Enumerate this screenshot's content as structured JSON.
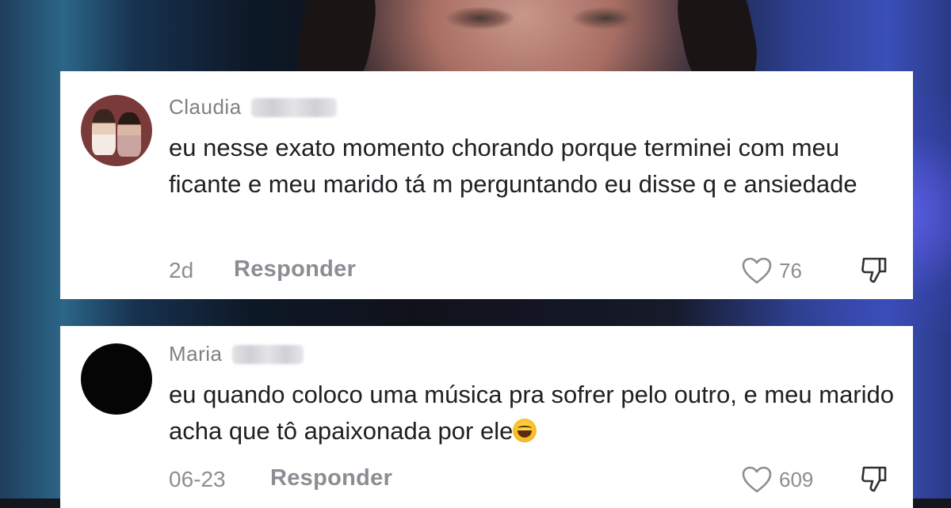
{
  "comments": [
    {
      "author": "Claudia",
      "text": "eu nesse exato momento chorando porque terminei com meu ficante e meu marido tá m perguntando eu disse q e ansiedade",
      "date": "2d",
      "reply_label": "Responder",
      "likes": "76"
    },
    {
      "author": "Maria",
      "text": "eu quando coloco uma música pra sofrer pelo outro, e meu marido acha que tô apaixonada por ele",
      "date": "06-23",
      "reply_label": "Responder",
      "likes": "609"
    }
  ],
  "icons": {
    "like": "heart-outline-icon",
    "dislike": "thumbs-down-outline-icon",
    "emoji": "grinning-sweat-emoji"
  },
  "colors": {
    "card_bg": "#ffffff",
    "text": "#202024",
    "muted": "#8c8c93"
  }
}
